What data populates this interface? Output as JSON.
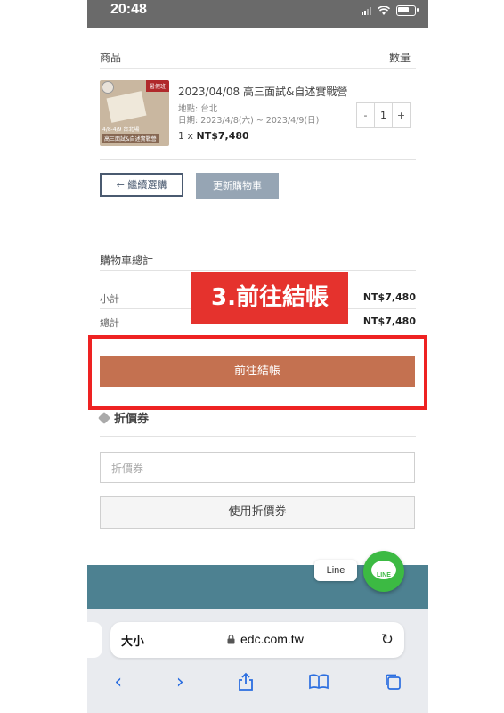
{
  "status_bar": {
    "time": "20:48"
  },
  "cart": {
    "header_product": "商品",
    "header_qty": "數量",
    "item": {
      "thumb_badge": "暑假班",
      "thumb_caption_1": "4/8-4/9 台北場",
      "thumb_caption_2": "高三面試&自述實戰營",
      "title": "2023/04/08 高三面試&自述實戰營",
      "location": "地點: 台北",
      "date": "日期: 2023/4/8(六) ~ 2023/4/9(日)",
      "price_prefix": "1 x ",
      "price": "NT$7,480",
      "qty_minus": "-",
      "qty_value": "1",
      "qty_plus": "+"
    },
    "continue_label": "← 繼續選購",
    "update_label": "更新購物車"
  },
  "totals": {
    "title": "購物車總計",
    "subtotal_label": "小計",
    "subtotal_value": "NT$7,480",
    "total_label": "總計",
    "total_value": "NT$7,480",
    "checkout_label": "前往結帳"
  },
  "annotation": {
    "text": "3.前往結帳"
  },
  "coupon": {
    "title": "折價券",
    "placeholder": "折價券",
    "apply_label": "使用折價券"
  },
  "line_widget": {
    "bubble": "Line",
    "badge": "LINE"
  },
  "browser": {
    "aa_label": "大小",
    "url": "edc.com.tw",
    "reload_icon": "reload-icon",
    "toolbar_icons": [
      "back-icon",
      "forward-icon",
      "share-icon",
      "bookmarks-icon",
      "tabs-icon"
    ]
  },
  "colors": {
    "checkout": "#c47150",
    "update_button": "#96a5b4",
    "annotation": "#e5322d",
    "footer": "#4d8191",
    "line_green": "#3cba43"
  }
}
